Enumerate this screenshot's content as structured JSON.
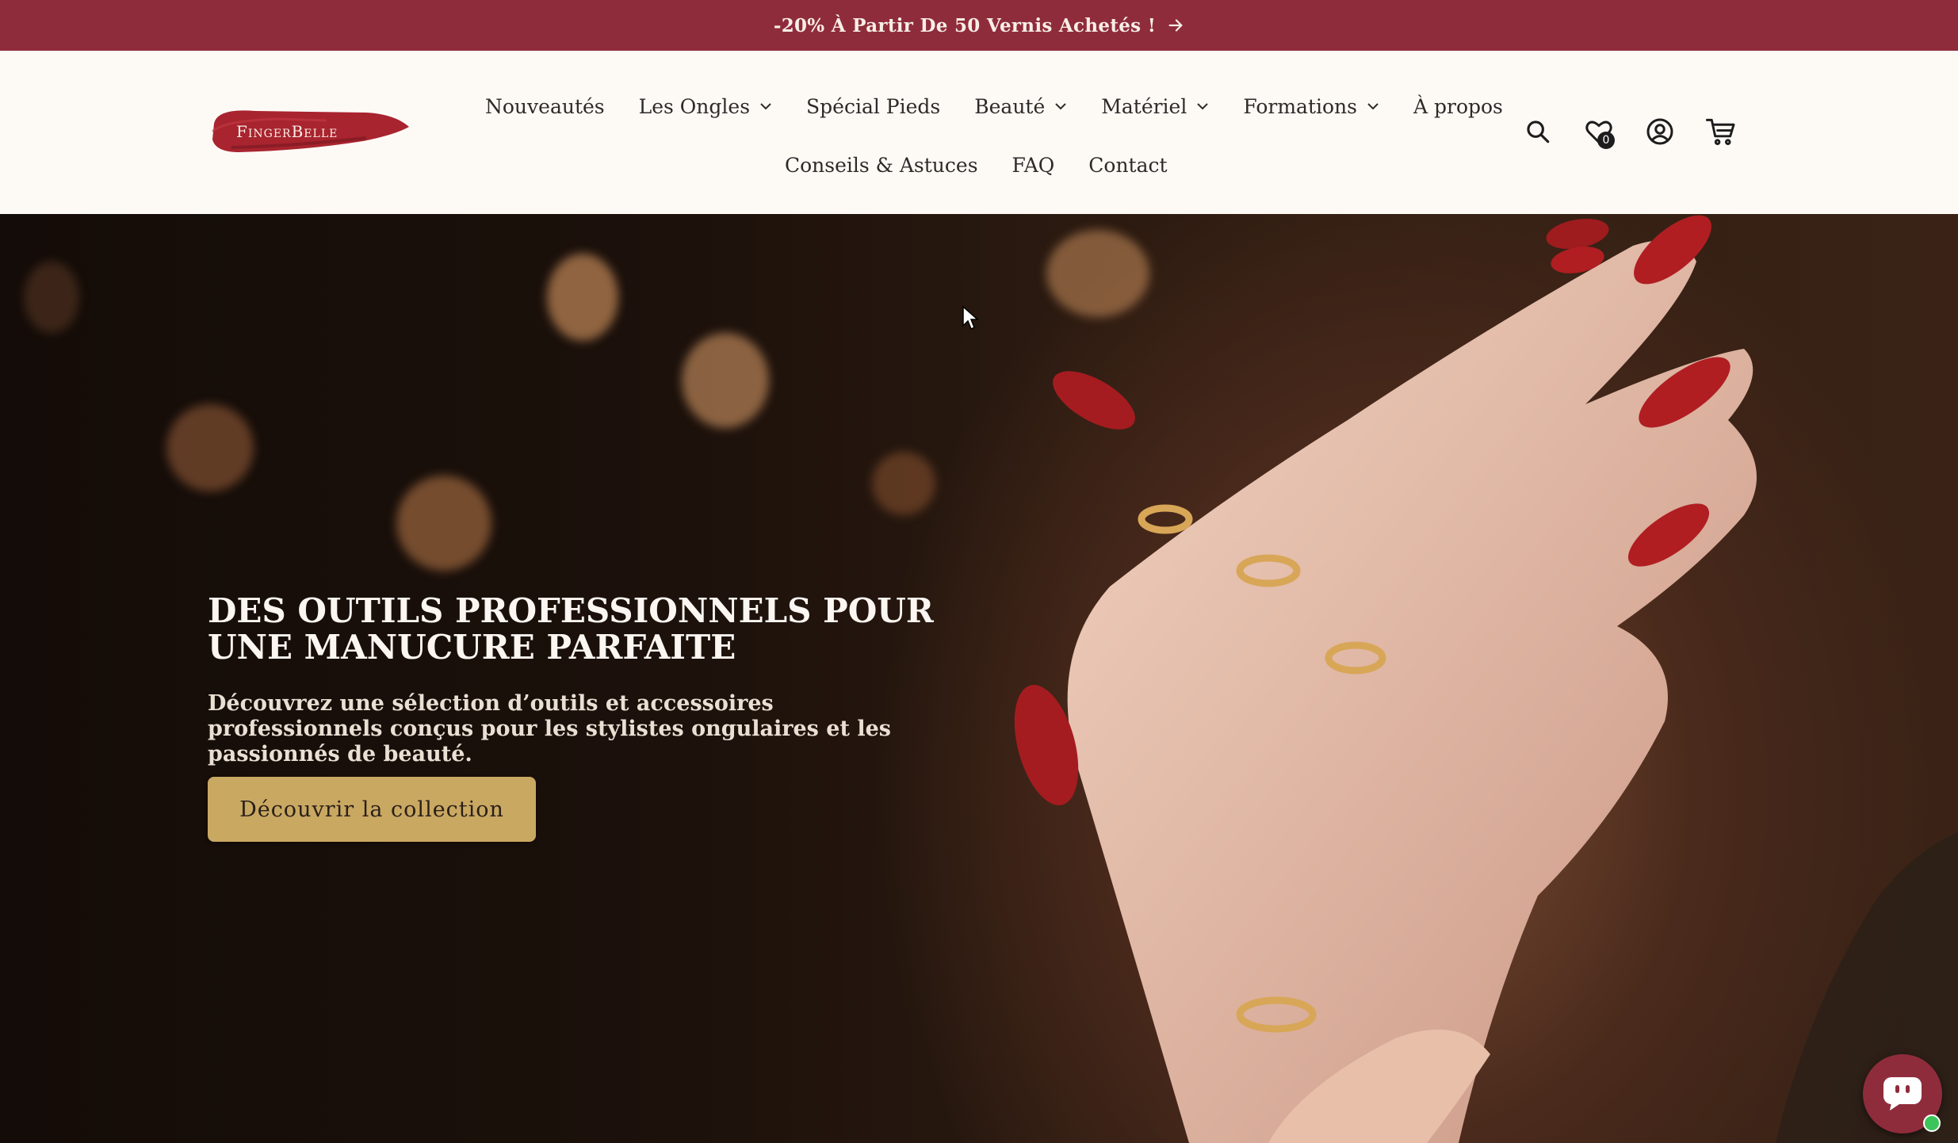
{
  "announcement": {
    "text": "-20% À Partir De 50 Vernis Achetés !",
    "icon": "arrow-right-icon"
  },
  "header": {
    "logo_text": "FingerBelle",
    "nav_row1": [
      "Nouveautés",
      "Les Ongles",
      "Spécial Pieds",
      "Beauté",
      "Matériel",
      "Formations",
      "À propos"
    ],
    "nav_row2": [
      "Conseils & Astuces",
      "FAQ",
      "Contact"
    ],
    "wishlist_count": "0",
    "icons": [
      "search-icon",
      "heart-icon",
      "account-icon",
      "cart-icon"
    ]
  },
  "hero": {
    "title": "DES OUTILS PROFESSIONNELS POUR UNE MANUCURE PARFAITE",
    "subtitle": "Découvrez une sélection d’outils et accessoires professionnels conçus pour les stylistes ongulaires et les passionnés de beauté.",
    "cta_label": "Découvrir la collection"
  },
  "colors": {
    "brand": "#8f2c3b",
    "cta": "#c9a862",
    "header_bg": "#fdfaf6"
  }
}
